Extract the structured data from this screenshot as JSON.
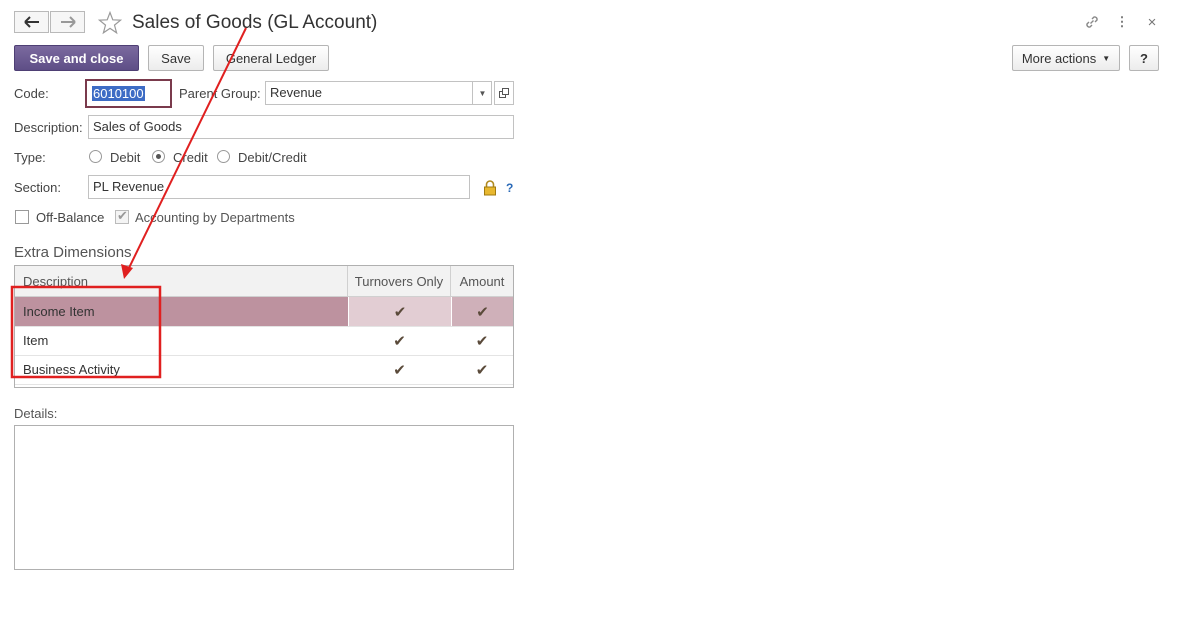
{
  "window": {
    "title": "Sales of Goods (GL Account)"
  },
  "toolbar": {
    "save_close": "Save and close",
    "save": "Save",
    "general_ledger": "General Ledger",
    "more_actions": "More actions",
    "help": "?"
  },
  "form": {
    "code_label": "Code:",
    "code_value": "6010100",
    "parent_label": "Parent Group:",
    "parent_value": "Revenue",
    "description_label": "Description:",
    "description_value": "Sales of Goods",
    "type_label": "Type:",
    "type_options": [
      "Debit",
      "Credit",
      "Debit/Credit"
    ],
    "type_selected": "Credit",
    "section_label": "Section:",
    "section_value": "PL Revenue",
    "section_help": "?",
    "off_balance_label": "Off-Balance",
    "off_balance_checked": false,
    "accounting_label": "Accounting by Departments",
    "accounting_checked": true
  },
  "extra_dimensions": {
    "title": "Extra Dimensions",
    "columns": [
      "Description",
      "Turnovers Only",
      "Amount"
    ],
    "rows": [
      {
        "description": "Income Item",
        "turnovers_only": true,
        "amount": true,
        "selected": true
      },
      {
        "description": "Item",
        "turnovers_only": true,
        "amount": true,
        "selected": false
      },
      {
        "description": "Business Activity",
        "turnovers_only": true,
        "amount": true,
        "selected": false
      }
    ]
  },
  "details": {
    "label": "Details:",
    "value": ""
  },
  "colors": {
    "primary_button": "#5e4e86",
    "selected_row": "#bd929f",
    "annotation": "#e02020"
  }
}
